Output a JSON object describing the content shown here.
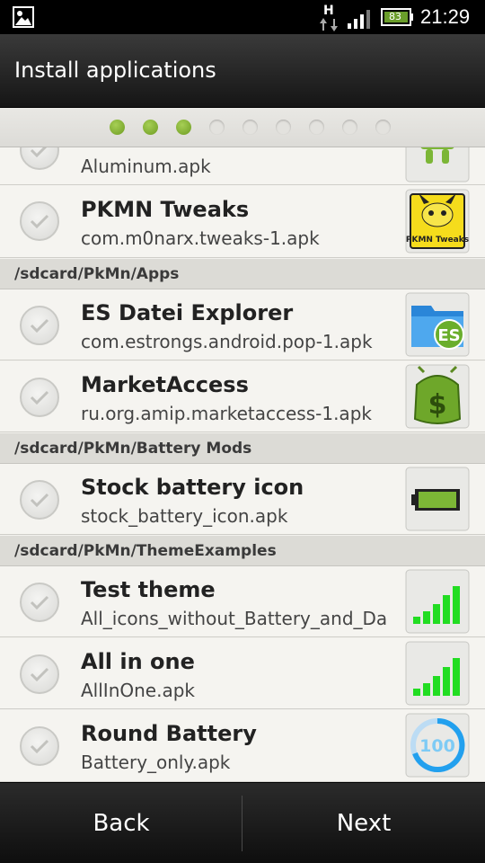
{
  "status_bar": {
    "network_type": "H",
    "battery_level": "83",
    "time": "21:29",
    "icons": [
      "image-notification-icon",
      "data-transfer-icon",
      "signal-strength-icon",
      "battery-icon"
    ]
  },
  "title": "Install applications",
  "pager": {
    "total": 9,
    "active": 3,
    "active_color": "#8cbd3a"
  },
  "list": [
    {
      "kind": "item",
      "title": "",
      "sub": "Aluminum.apk",
      "icon": "android-robot-icon"
    },
    {
      "kind": "item",
      "title": "PKMN Tweaks",
      "sub": "com.m0narx.tweaks-1.apk",
      "icon": "pikachu-android-icon",
      "icon_text": "PKMN Tweaks"
    },
    {
      "kind": "section",
      "label": "/sdcard/PkMn/Apps"
    },
    {
      "kind": "item",
      "title": "ES Datei Explorer",
      "sub": "com.estrongs.android.pop-1.apk",
      "icon": "es-file-explorer-icon"
    },
    {
      "kind": "item",
      "title": "MarketAccess",
      "sub": "ru.org.amip.marketaccess-1.apk",
      "icon": "market-access-icon"
    },
    {
      "kind": "section",
      "label": "/sdcard/PkMn/Battery Mods"
    },
    {
      "kind": "item",
      "title": "Stock battery icon",
      "sub": "stock_battery_icon.apk",
      "icon": "battery-icon"
    },
    {
      "kind": "section",
      "label": "/sdcard/PkMn/ThemeExamples"
    },
    {
      "kind": "item",
      "title": "Test theme",
      "sub": "All_icons_without_Battery_and_Da",
      "icon": "signal-bars-icon"
    },
    {
      "kind": "item",
      "title": "All in one",
      "sub": "AllInOne.apk",
      "icon": "signal-bars-icon"
    },
    {
      "kind": "item",
      "title": "Round Battery",
      "sub": "Battery_only.apk",
      "icon": "round-battery-icon",
      "icon_text": "100"
    }
  ],
  "buttons": {
    "back": "Back",
    "next": "Next"
  }
}
